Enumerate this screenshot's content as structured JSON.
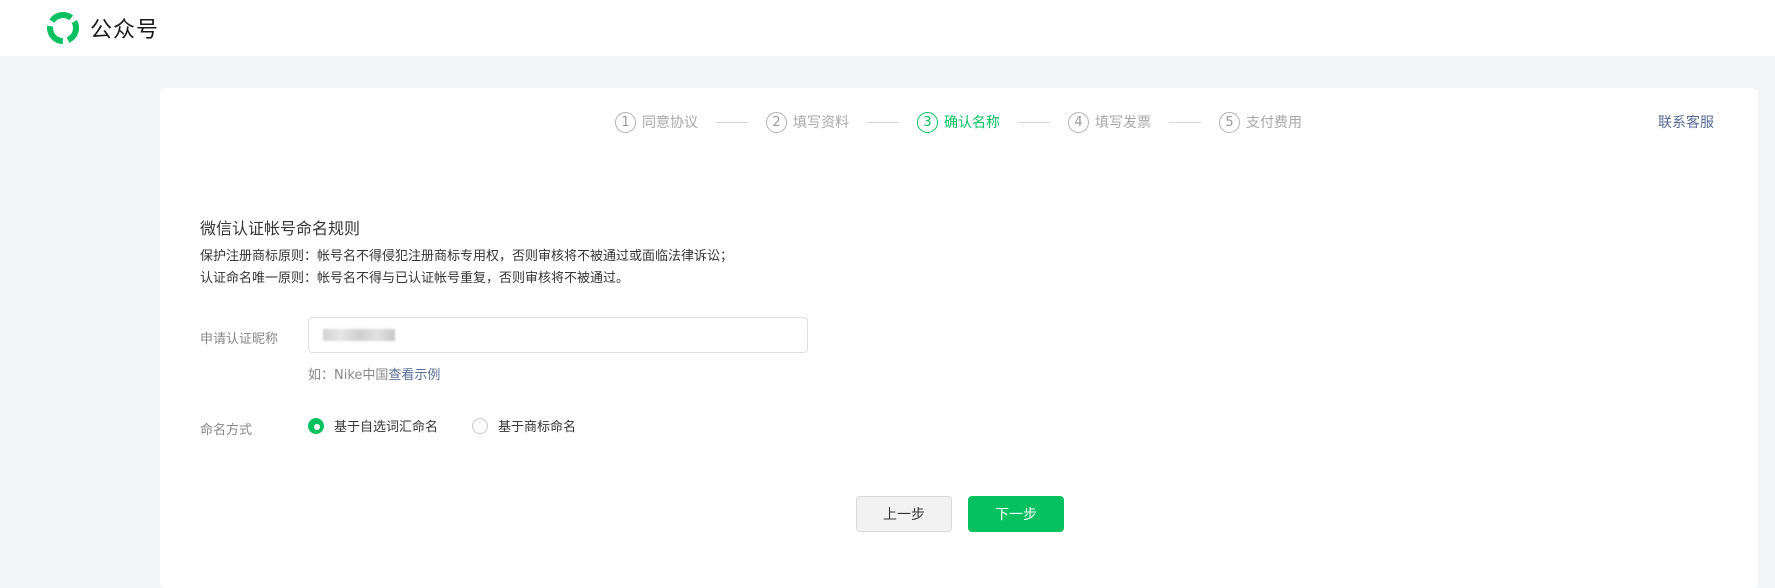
{
  "header": {
    "brand_name": "公众号",
    "logo_icon": "wechat-official-account-logo-icon",
    "brand_color": "#07c160"
  },
  "stepper": {
    "steps": [
      {
        "num": "1",
        "label": "同意协议",
        "state": "done"
      },
      {
        "num": "2",
        "label": "填写资料",
        "state": "done"
      },
      {
        "num": "3",
        "label": "确认名称",
        "state": "active"
      },
      {
        "num": "4",
        "label": "填写发票",
        "state": "todo"
      },
      {
        "num": "5",
        "label": "支付费用",
        "state": "todo"
      }
    ]
  },
  "service_link": "联系客服",
  "rules": {
    "title": "微信认证帐号命名规则",
    "line1": "保护注册商标原则：帐号名不得侵犯注册商标专用权，否则审核将不被通过或面临法律诉讼；",
    "line2": "认证命名唯一原则：帐号名不得与已认证帐号重复，否则审核将不被通过。"
  },
  "form": {
    "nickname_label": "申请认证昵称",
    "nickname_value_state": "blurred",
    "hint_prefix": "如：Nike中国",
    "hint_link": "查看示例",
    "naming_label": "命名方式",
    "naming_options": [
      {
        "label": "基于自选词汇命名",
        "checked": true
      },
      {
        "label": "基于商标命名",
        "checked": false
      }
    ]
  },
  "buttons": {
    "prev": "上一步",
    "next": "下一步"
  },
  "colors": {
    "accent": "#07c160",
    "link": "#576b95",
    "page_bg": "#f4f5f7"
  }
}
